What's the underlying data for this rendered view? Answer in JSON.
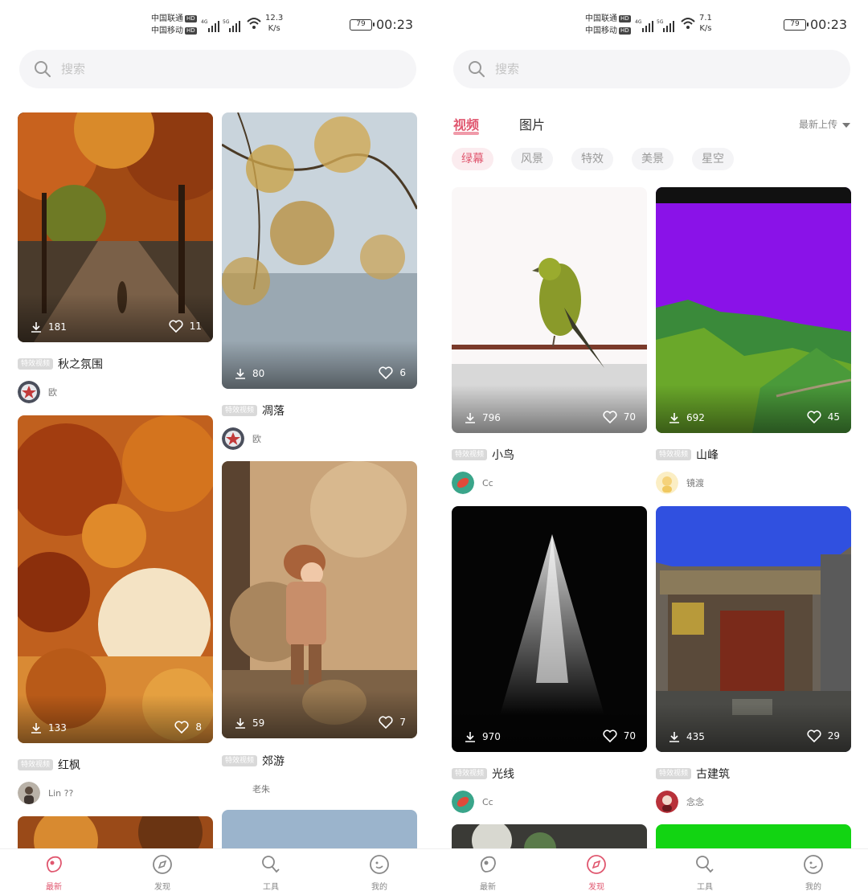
{
  "status_bar": {
    "carrier_1": "中国联通",
    "carrier_2": "中国移动",
    "hd_badge": "HD",
    "net_type_1": "4G",
    "net_type_2": "5G",
    "battery": "79"
  },
  "left": {
    "status": {
      "speed_value": "12.3",
      "speed_unit": "K/s",
      "time": "00:23"
    },
    "search_placeholder": "搜索",
    "cards": [
      {
        "badge": "特效视频",
        "title": "秋之氛围",
        "author": "欧",
        "downloads": "181",
        "likes": "11"
      },
      {
        "badge": "特效视频",
        "title": "凋落",
        "author": "欧",
        "downloads": "80",
        "likes": "6"
      },
      {
        "badge": "特效视频",
        "title": "红枫",
        "author": "Lin ??",
        "downloads": "133",
        "likes": "8"
      },
      {
        "badge": "特效视频",
        "title": "郊游",
        "author": "老朱",
        "downloads": "59",
        "likes": "7"
      }
    ],
    "nav_active": "最新"
  },
  "right": {
    "status": {
      "speed_value": "7.1",
      "speed_unit": "K/s",
      "time": "00:23"
    },
    "search_placeholder": "搜索",
    "tabs": [
      "视频",
      "图片"
    ],
    "active_tab": "视频",
    "sort_label": "最新上传",
    "filters": [
      "绿幕",
      "风景",
      "特效",
      "美景",
      "星空"
    ],
    "active_filter": "绿幕",
    "cards": [
      {
        "badge": "特效视频",
        "title": "小鸟",
        "author": "Cc",
        "downloads": "796",
        "likes": "70"
      },
      {
        "badge": "特效视频",
        "title": "山峰",
        "author": "镜渡",
        "downloads": "692",
        "likes": "45"
      },
      {
        "badge": "特效视频",
        "title": "光线",
        "author": "Cc",
        "downloads": "970",
        "likes": "70"
      },
      {
        "badge": "特效视频",
        "title": "古建筑",
        "author": "念念",
        "downloads": "435",
        "likes": "29"
      }
    ],
    "nav_active": "发现"
  },
  "nav": [
    {
      "label": "最新",
      "icon": "bean-icon"
    },
    {
      "label": "发现",
      "icon": "compass-icon"
    },
    {
      "label": "工具",
      "icon": "tools-icon"
    },
    {
      "label": "我的",
      "icon": "profile-icon"
    }
  ],
  "colors": {
    "accent": "#e0576f",
    "chip_bg": "#f4f4f6",
    "search_bg": "#f5f5f7"
  }
}
